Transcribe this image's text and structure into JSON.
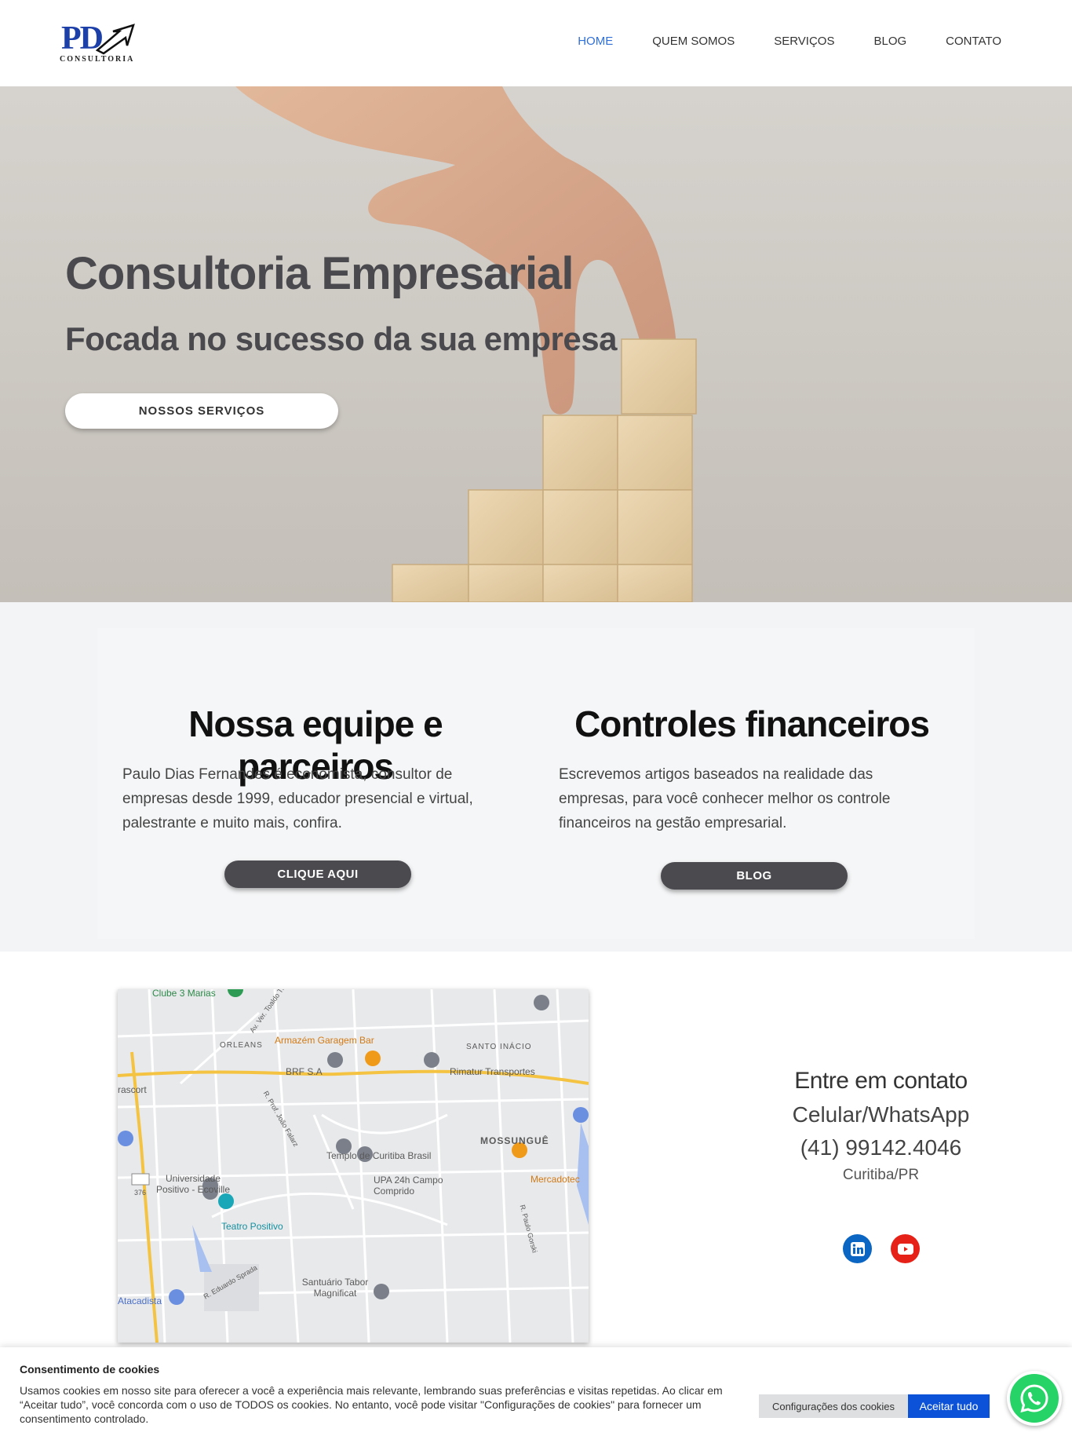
{
  "header": {
    "logo_text": "PD",
    "logo_sub": "CONSULTORIA",
    "nav": [
      {
        "label": "HOME",
        "active": true
      },
      {
        "label": "QUEM SOMOS",
        "active": false
      },
      {
        "label": "SERVIÇOS",
        "active": false
      },
      {
        "label": "BLOG",
        "active": false
      },
      {
        "label": "CONTATO",
        "active": false
      }
    ]
  },
  "hero": {
    "title": "Consultoria Empresarial",
    "subtitle": "Focada no sucesso da sua empresa",
    "button": "NOSSOS SERVIÇOS"
  },
  "features": [
    {
      "title": "Nossa equipe e parceiros",
      "text": "Paulo Dias Fernandes é economista, consultor de empresas desde 1999, educador presencial e virtual, palestrante e muito mais, confira.",
      "button": "CLIQUE AQUI"
    },
    {
      "title": "Controles financeiros",
      "text": "Escrevemos artigos baseados na realidade das empresas, para você conhecer melhor os controle financeiros na gestão empresarial.",
      "button": "BLOG"
    }
  ],
  "map": {
    "labels": [
      "Clube 3 Marias",
      "Av. Ver. Toaldo Tu",
      "ORLEANS",
      "Armazém Garagem Bar",
      "SANTO INÁCIO",
      "BRF S.A",
      "Rimatur Transportes",
      "rascort",
      "R. Prof. João Falarz",
      "MOSSUNGUÊ",
      "Templo de Curitiba Brasil",
      "Universidade Positivo - Ecoville",
      "UPA 24h Campo Comprido",
      "Mercadotec",
      "R. Paulo Gorski",
      "376",
      "Teatro Positivo",
      "R. Eduardo Sprada",
      "Santuário Tabor Magnificat",
      "Atacadista"
    ]
  },
  "contact": {
    "title": "Entre em contato",
    "line": "Celular/WhatsApp",
    "phone": "(41) 99142.4046",
    "city": "Curitiba/PR"
  },
  "cookie": {
    "title": "Consentimento de cookies",
    "text": "Usamos cookies em nosso site para oferecer a você a experiência mais relevante, lembrando suas preferências e visitas repetidas. Ao clicar em “Aceitar tudo”, você concorda com o uso de TODOS os cookies. No entanto, você pode visitar \"Configurações de cookies\" para fornecer um consentimento controlado.",
    "settings": "Configurações dos cookies",
    "accept": "Aceitar tudo"
  },
  "colors": {
    "accent": "#2f6fd6",
    "button_dark": "#4a4a4f",
    "cookie_accept": "#0b52d8",
    "whatsapp": "#25d366"
  }
}
